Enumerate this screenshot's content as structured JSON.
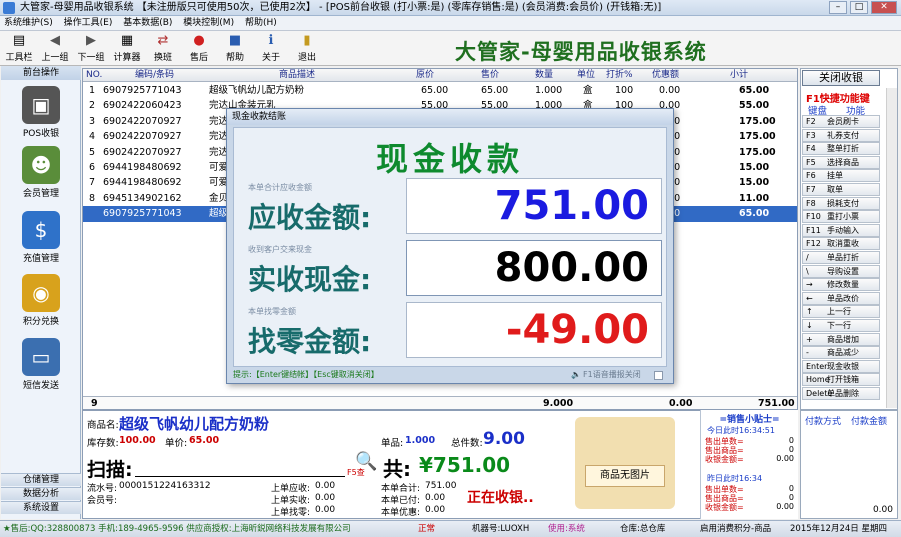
{
  "window": {
    "title": "大管家-母婴用品收银系统 【未注册版只可使用50次，已使用2次】 - [POS前台收银 (打小票:是) (零库存销售:是) (会员消费:会员价) (开钱箱:无)]"
  },
  "menu": [
    "系统维护(S)",
    "操作工具(E)",
    "基本数据(B)",
    "模块控制(M)",
    "帮助(H)"
  ],
  "toolbar": {
    "buttons": [
      "工具栏",
      "上一组",
      "下一组",
      "计算器",
      "换班",
      "售后",
      "帮助",
      "关于",
      "退出"
    ],
    "banner": "大管家-母婴用品收银系统"
  },
  "leftnav": {
    "header": "前台操作",
    "items": [
      "POS收银",
      "会员管理",
      "充值管理",
      "积分兑换",
      "短信发送"
    ],
    "footer": [
      "仓储管理",
      "数据分析",
      "系统设置"
    ]
  },
  "grid": {
    "columns": [
      "NO.",
      "编码/条码",
      "商品描述",
      "原价",
      "售价",
      "数量",
      "单位",
      "打折%",
      "优惠额",
      "小计"
    ],
    "rows": [
      {
        "no": "1",
        "code": "6907925771043",
        "desc": "超级飞帆幼儿配方奶粉",
        "orig": "65.00",
        "price": "65.00",
        "qty": "1.000",
        "unit": "盒",
        "disc": "100",
        "off": "0.00",
        "sub": "65.00"
      },
      {
        "no": "2",
        "code": "6902422060423",
        "desc": "完达山金装元乳",
        "orig": "55.00",
        "price": "55.00",
        "qty": "1.000",
        "unit": "盒",
        "disc": "100",
        "off": "0.00",
        "sub": "55.00"
      },
      {
        "no": "3",
        "code": "6902422070927",
        "desc": "完达",
        "orig": "",
        "price": "",
        "qty": "",
        "unit": "",
        "disc": "",
        "off": "0.00",
        "sub": "175.00"
      },
      {
        "no": "4",
        "code": "6902422070927",
        "desc": "完达",
        "orig": "",
        "price": "",
        "qty": "",
        "unit": "",
        "disc": "",
        "off": "0.00",
        "sub": "175.00"
      },
      {
        "no": "5",
        "code": "6902422070927",
        "desc": "完达",
        "orig": "",
        "price": "",
        "qty": "",
        "unit": "",
        "disc": "",
        "off": "0.00",
        "sub": "175.00"
      },
      {
        "no": "6",
        "code": "6944198480692",
        "desc": "可爱",
        "orig": "",
        "price": "",
        "qty": "",
        "unit": "",
        "disc": "",
        "off": "0.00",
        "sub": "15.00"
      },
      {
        "no": "7",
        "code": "6944198480692",
        "desc": "可爱",
        "orig": "",
        "price": "",
        "qty": "",
        "unit": "",
        "disc": "",
        "off": "0.00",
        "sub": "15.00"
      },
      {
        "no": "8",
        "code": "6945134902162",
        "desc": "金贝",
        "orig": "",
        "price": "",
        "qty": "",
        "unit": "",
        "disc": "",
        "off": "0.00",
        "sub": "11.00"
      },
      {
        "no": "",
        "code": "6907925771043",
        "desc": "超级",
        "orig": "",
        "price": "",
        "qty": "",
        "unit": "",
        "disc": "",
        "off": "0.00",
        "sub": "65.00"
      }
    ],
    "footer": {
      "count": "9",
      "qty": "9.000",
      "off": "0.00",
      "total": "751.00"
    }
  },
  "rightpanel": {
    "close_btn": "关闭收银",
    "hotkey_title": "F1快捷功能键",
    "col_key": "键盘",
    "col_func": "功能",
    "hotkeys": [
      [
        "F2",
        "会员刷卡"
      ],
      [
        "F3",
        "礼券支付"
      ],
      [
        "F4",
        "整单打折"
      ],
      [
        "F5",
        "选择商品"
      ],
      [
        "F6",
        "挂单"
      ],
      [
        "F7",
        "取单"
      ],
      [
        "F8",
        "损耗支付"
      ],
      [
        "F10",
        "重打小票"
      ],
      [
        "F11",
        "手动输入"
      ],
      [
        "F12",
        "取消重收"
      ],
      [
        "/",
        "单品打折"
      ],
      [
        "\\",
        "导购设置"
      ],
      [
        "→",
        "修改数量"
      ],
      [
        "←",
        "单品改价"
      ],
      [
        "↑",
        "上一行"
      ],
      [
        "↓",
        "下一行"
      ],
      [
        "+",
        "商品增加"
      ],
      [
        "-",
        "商品减少"
      ],
      [
        "Enter",
        "现金收银"
      ],
      [
        "Home",
        "打开钱箱"
      ],
      [
        "Delete",
        "单品删除"
      ]
    ]
  },
  "info": {
    "product_label": "商品名:",
    "product_name": "超级飞帆幼儿配方奶粉",
    "stock_label": "库存数:",
    "stock": "100.00",
    "unitprice_label": "单价:",
    "unitprice": "65.00",
    "single_label": "单品:",
    "single": "1.000",
    "totalcount_label": "总件数:",
    "totalcount": "9.00",
    "scan_label": "扫描:",
    "f5_label": "F5查",
    "total_label": "共:",
    "total": "¥751.00",
    "serial_label": "流水号:",
    "serial": "0000151224163312",
    "member_label": "会员号:",
    "last_recv_label": "上单应收:",
    "last_recv": "0.00",
    "last_paid_label": "上单实收:",
    "last_paid": "0.00",
    "last_change_label": "上单找零:",
    "last_change": "0.00",
    "this_total_label": "本单合计:",
    "this_total": "751.00",
    "this_paid_label": "本单已付:",
    "this_paid": "0.00",
    "this_off_label": "本单优惠:",
    "this_off": "0.00",
    "collecting": "正在收银..",
    "no_image": "商品无图片"
  },
  "tips": {
    "title": "=销售小贴士=",
    "today": "今日此时16:34:51",
    "yesterday": "昨日此时16:34",
    "labels": [
      "售出单数=",
      "售出商品=",
      "收银金额="
    ],
    "today_vals": [
      "0",
      "0",
      "0.00"
    ],
    "yesterday_vals": [
      "0",
      "0",
      "0.00"
    ]
  },
  "pay": {
    "col1": "付款方式",
    "col2": "付款金额",
    "total": "0.00"
  },
  "status": {
    "s1": "★售后:QQ:328800873 手机:189-4965-9596 供应商授权:上海昕鋭网络科技发展有限公司",
    "s2": "正常",
    "s3": "机器号:LUOXH",
    "s4": "使用:系统",
    "s5": "仓库:总仓库",
    "s6": "启用消费积分-商品",
    "s7": "2015年12月24日 星期四"
  },
  "dialog": {
    "title": "现金收款结账",
    "heading": "现金收款",
    "recv_hint": "本单合计应收金额",
    "recv_label": "应收金额:",
    "recv_value": "751.00",
    "paid_hint": "收到客户交来现金",
    "paid_label": "实收现金:",
    "paid_value": "800.00",
    "change_hint": "本单找零金额",
    "change_label": "找零金额:",
    "change_value": "-49.00",
    "foot_tip": "提示:【Enter键结帐】【Esc键取消关闭】",
    "voice_label": "F1语音播报关闭",
    "colors": {
      "recv": "#1b1be0",
      "paid": "#000000",
      "change": "#e01b1b"
    }
  }
}
